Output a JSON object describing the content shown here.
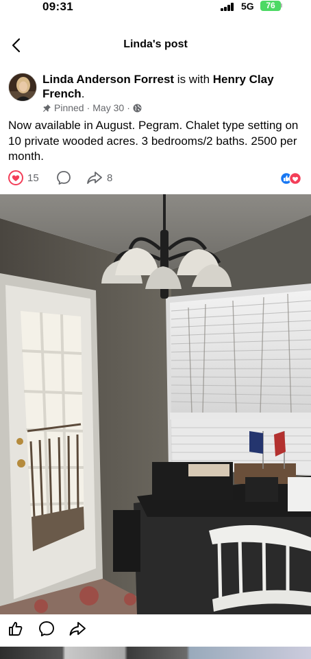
{
  "status_bar": {
    "time": "09:31",
    "network": "5G",
    "battery": "76"
  },
  "header": {
    "title": "Linda's post"
  },
  "post": {
    "author": "Linda Anderson Forrest",
    "connector": " is with ",
    "tagged": "Henry Clay French",
    "tagged_suffix": ".",
    "pinned_label": "Pinned",
    "date": "May 30",
    "privacy_icon": "globe-icon",
    "text": "Now available in August. Pegram. Chalet type setting on 10 private wooded acres. 3 bedrooms/2 baths. 2500 per month."
  },
  "engagement": {
    "reactions_count": "15",
    "comments_count": "",
    "shares_count": "8"
  },
  "colors": {
    "like_blue": "#1877f2",
    "love_red": "#f33e58",
    "battery_green": "#4cd964",
    "meta_gray": "#65676b"
  }
}
